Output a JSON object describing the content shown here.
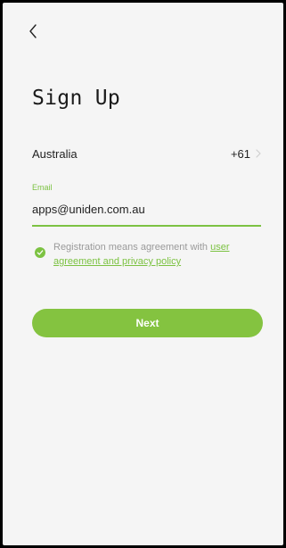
{
  "header": {
    "back_icon": "chevron-left-icon",
    "title": "Sign Up"
  },
  "form": {
    "country": {
      "name": "Australia",
      "dial_code": "+61",
      "chevron_icon": "chevron-right-icon"
    },
    "email": {
      "label": "Email",
      "value": "apps@uniden.com.au"
    },
    "agreement": {
      "checked": true,
      "text": "Registration means agreement with ",
      "link_part1": "user",
      "link_part2": "agreement and privacy policy"
    },
    "next_label": "Next"
  },
  "colors": {
    "accent": "#7cc242",
    "button": "#84c340",
    "background": "#f5f5f5",
    "muted_text": "#9a9a9a"
  }
}
